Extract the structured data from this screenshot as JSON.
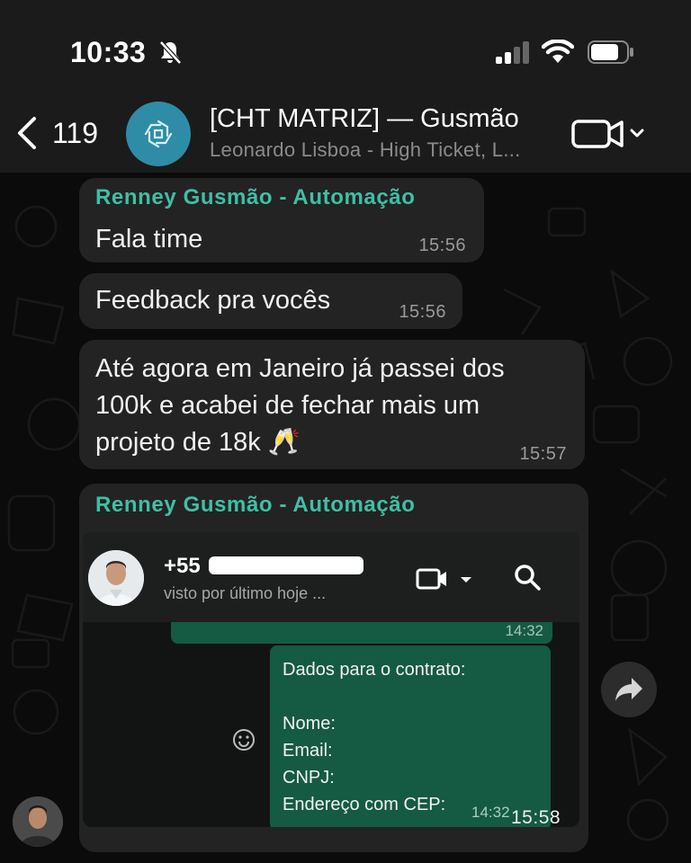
{
  "status_bar": {
    "time": "10:33"
  },
  "header": {
    "back_count": "119",
    "title": "[CHT MATRIZ] — Gusmão",
    "subtitle": "Leonardo Lisboa - High Ticket, L..."
  },
  "messages": [
    {
      "sender": "Renney Gusmão - Automação",
      "text": "Fala time",
      "time": "15:56"
    },
    {
      "text": "Feedback pra vocês",
      "time": "15:56"
    },
    {
      "lines": [
        "Até agora em Janeiro já passei dos",
        "100k e acabei de fechar mais um",
        "projeto de 18k 🥂"
      ],
      "time": "15:57"
    },
    {
      "sender": "Renney Gusmão - Automação",
      "time": "15:58"
    }
  ],
  "embedded_screenshot": {
    "contact_name": "+55",
    "last_seen": "visto por último hoje ...",
    "prev_message_time": "14:32",
    "message_lines": [
      "Dados para o contrato:",
      "",
      "Nome:",
      "Email:",
      "CNPJ:",
      "Endereço com CEP:"
    ],
    "message_time": "14:32"
  },
  "colors": {
    "sender_name": "#3fbfa5",
    "bubble": "#232323",
    "group_avatar": "#2f8ca6",
    "outgoing_bubble_embedded": "#155a43"
  },
  "icons": [
    "bell-slash-icon",
    "cellular-signal-icon",
    "wifi-icon",
    "battery-icon",
    "back-chevron-icon",
    "video-call-icon",
    "chevron-down-icon",
    "forward-icon",
    "search-icon",
    "emoji-icon"
  ]
}
